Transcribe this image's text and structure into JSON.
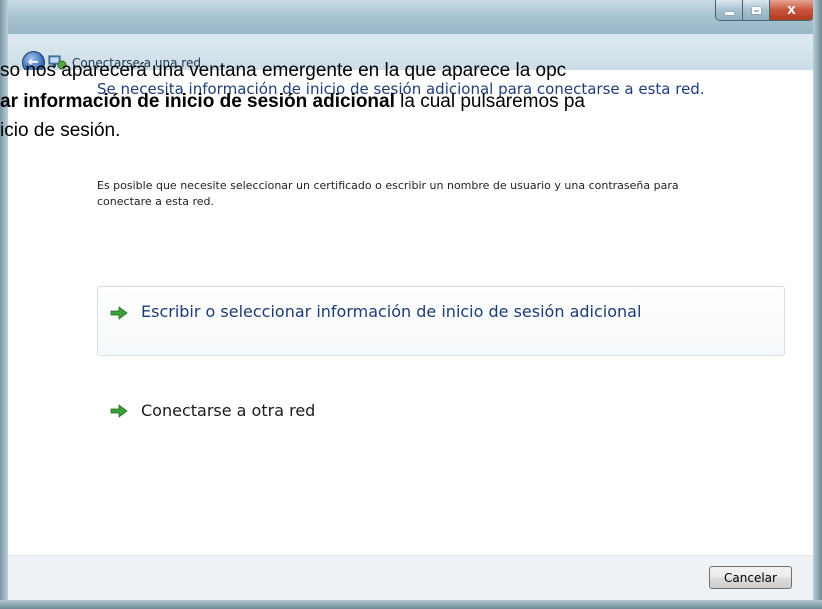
{
  "window": {
    "nav_title": "Conectarse a una red",
    "minimize_icon": "minimize-icon",
    "maximize_icon": "maximize-icon",
    "close_icon": "close-icon",
    "close_glyph": "X"
  },
  "content": {
    "heading": "Se necesita información de inicio de sesión adicional para conectarse a esta red.",
    "description": "Es posible que necesite seleccionar un certificado o escribir un nombre de usuario y una contraseña para conectare a esta red.",
    "options": [
      {
        "label": "Escribir o seleccionar información de inicio de sesión adicional",
        "icon": "green-arrow-icon"
      },
      {
        "label": "Conectarse a otra red",
        "icon": "green-arrow-icon"
      }
    ],
    "cancel_label": "Cancelar"
  },
  "overlay_text": {
    "line1": "so nos aparecerá una ventana emergente en la que aparece la opc",
    "line2_bold": "ar información de inicio de sesión adicional",
    "line2_rest": " la cual pulsaremos pa",
    "line3": "icio de sesión."
  },
  "colors": {
    "heading_blue": "#1e3d7a",
    "arrow_green": "#3aa13a",
    "close_red": "#c8553b"
  }
}
